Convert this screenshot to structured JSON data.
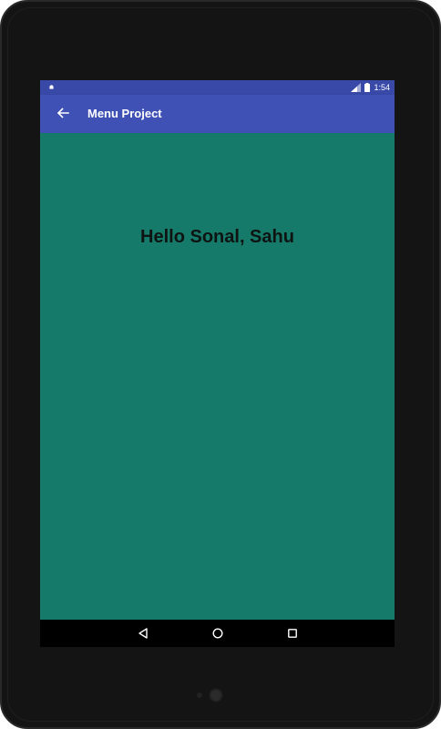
{
  "status_bar": {
    "time": "1:54",
    "left_icon": "android-notification-icon",
    "right_icons": [
      "signal-icon",
      "battery-icon"
    ]
  },
  "app_bar": {
    "title": "Menu Project",
    "back_icon": "arrow-left-icon"
  },
  "content": {
    "greeting": "Hello Sonal, Sahu"
  },
  "navigation_bar": {
    "buttons": [
      "back-triangle-icon",
      "home-circle-icon",
      "recents-square-icon"
    ]
  },
  "colors": {
    "status_bar": "#3849a8",
    "app_bar": "#3f51b5",
    "background": "#157a69",
    "nav_bar": "#000000",
    "device_frame": "#141414"
  }
}
